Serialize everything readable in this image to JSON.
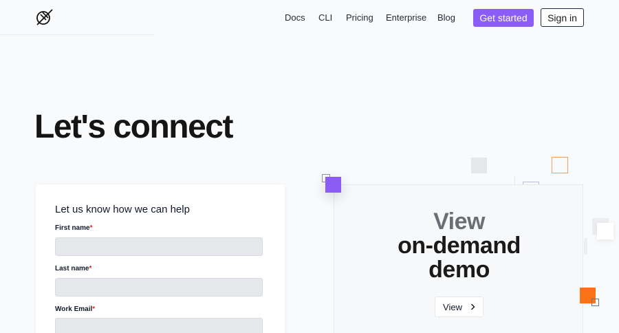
{
  "header": {
    "nav": [
      {
        "label": "Docs"
      },
      {
        "label": "CLI"
      },
      {
        "label": "Pricing"
      },
      {
        "label": "Enterprise"
      },
      {
        "label": "Blog"
      }
    ],
    "get_started_label": "Get started",
    "sign_in_label": "Sign in"
  },
  "hero": {
    "title": "Let's connect"
  },
  "form": {
    "title": "Let us know how we can help",
    "fields": [
      {
        "label": "First name",
        "required_mark": "*"
      },
      {
        "label": "Last name",
        "required_mark": "*"
      },
      {
        "label": "Work Email",
        "required_mark": "*"
      }
    ]
  },
  "demo": {
    "title_line1": "View",
    "title_line2": "on-demand",
    "title_line3": "demo",
    "button_label": "View"
  },
  "colors": {
    "accent_purple": "#8b5cf6",
    "accent_orange": "#f97316"
  },
  "icons": [
    "logo-icon",
    "chevron-right-icon"
  ]
}
